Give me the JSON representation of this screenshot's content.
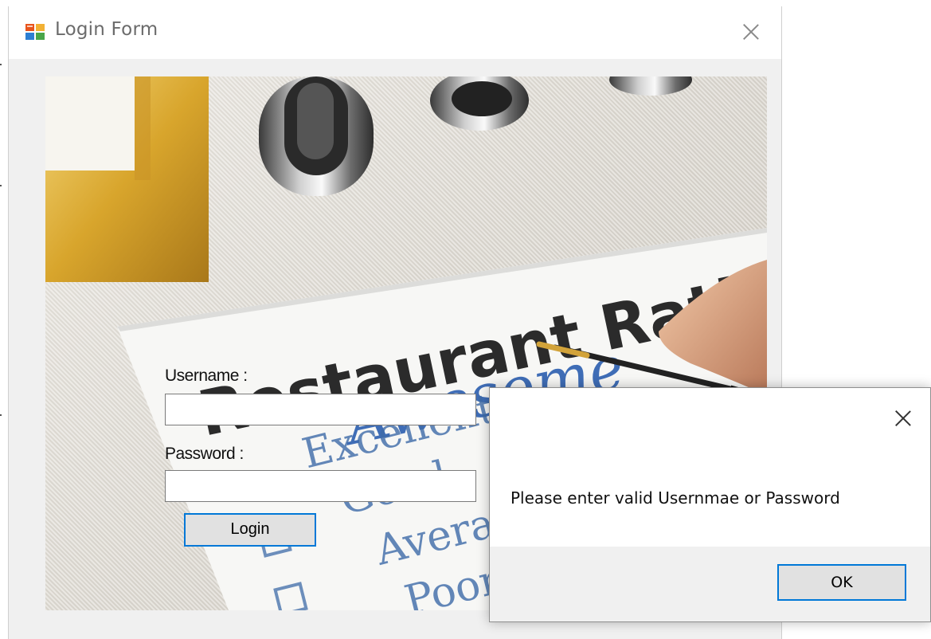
{
  "login_window": {
    "title": "Login Form",
    "icon": "windows-form-icon",
    "username_label": "Username :",
    "username_value": "",
    "password_label": "Password :",
    "password_value": "",
    "login_label": "Login",
    "background_image": {
      "heading": "Restaurant Rating",
      "handwriting": "Awesome",
      "options": [
        "Excellent",
        "Good",
        "Average",
        "Poor"
      ]
    }
  },
  "message_box": {
    "message": "Please enter valid Usernmae or Password",
    "ok_label": "OK"
  },
  "colors": {
    "accent_focus": "#0078d7",
    "window_bg": "#f0f0f0",
    "button_bg": "#e1e1e1"
  }
}
